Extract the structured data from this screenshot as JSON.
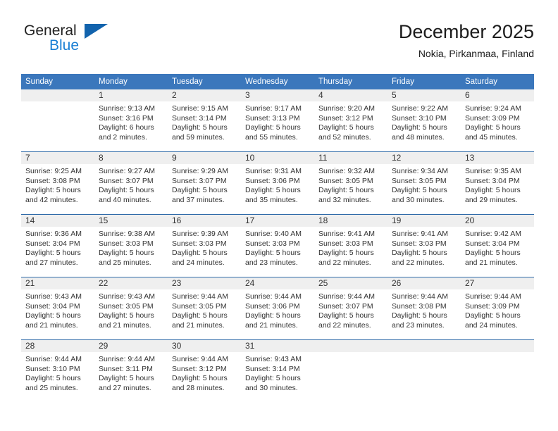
{
  "brand": {
    "line1": "General",
    "line2": "Blue",
    "triangle_color": "#1263ad",
    "blue_color": "#1a7fd4"
  },
  "header": {
    "title": "December 2025",
    "subtitle": "Nokia, Pirkanmaa, Finland"
  },
  "theme": {
    "header_row_bg": "#3b77bc",
    "header_row_text": "#ffffff",
    "week_divider": "#2e6aa8",
    "date_band_bg": "#efefef",
    "body_text": "#333333"
  },
  "weekday_headers": [
    "Sunday",
    "Monday",
    "Tuesday",
    "Wednesday",
    "Thursday",
    "Friday",
    "Saturday"
  ],
  "weeks": [
    [
      {
        "date": "",
        "sunrise": "",
        "sunset": "",
        "daylight_line1": "",
        "daylight_line2": "",
        "empty": true
      },
      {
        "date": "1",
        "sunrise": "Sunrise: 9:13 AM",
        "sunset": "Sunset: 3:16 PM",
        "daylight_line1": "Daylight: 6 hours",
        "daylight_line2": "and 2 minutes.",
        "empty": false
      },
      {
        "date": "2",
        "sunrise": "Sunrise: 9:15 AM",
        "sunset": "Sunset: 3:14 PM",
        "daylight_line1": "Daylight: 5 hours",
        "daylight_line2": "and 59 minutes.",
        "empty": false
      },
      {
        "date": "3",
        "sunrise": "Sunrise: 9:17 AM",
        "sunset": "Sunset: 3:13 PM",
        "daylight_line1": "Daylight: 5 hours",
        "daylight_line2": "and 55 minutes.",
        "empty": false
      },
      {
        "date": "4",
        "sunrise": "Sunrise: 9:20 AM",
        "sunset": "Sunset: 3:12 PM",
        "daylight_line1": "Daylight: 5 hours",
        "daylight_line2": "and 52 minutes.",
        "empty": false
      },
      {
        "date": "5",
        "sunrise": "Sunrise: 9:22 AM",
        "sunset": "Sunset: 3:10 PM",
        "daylight_line1": "Daylight: 5 hours",
        "daylight_line2": "and 48 minutes.",
        "empty": false
      },
      {
        "date": "6",
        "sunrise": "Sunrise: 9:24 AM",
        "sunset": "Sunset: 3:09 PM",
        "daylight_line1": "Daylight: 5 hours",
        "daylight_line2": "and 45 minutes.",
        "empty": false
      }
    ],
    [
      {
        "date": "7",
        "sunrise": "Sunrise: 9:25 AM",
        "sunset": "Sunset: 3:08 PM",
        "daylight_line1": "Daylight: 5 hours",
        "daylight_line2": "and 42 minutes.",
        "empty": false
      },
      {
        "date": "8",
        "sunrise": "Sunrise: 9:27 AM",
        "sunset": "Sunset: 3:07 PM",
        "daylight_line1": "Daylight: 5 hours",
        "daylight_line2": "and 40 minutes.",
        "empty": false
      },
      {
        "date": "9",
        "sunrise": "Sunrise: 9:29 AM",
        "sunset": "Sunset: 3:07 PM",
        "daylight_line1": "Daylight: 5 hours",
        "daylight_line2": "and 37 minutes.",
        "empty": false
      },
      {
        "date": "10",
        "sunrise": "Sunrise: 9:31 AM",
        "sunset": "Sunset: 3:06 PM",
        "daylight_line1": "Daylight: 5 hours",
        "daylight_line2": "and 35 minutes.",
        "empty": false
      },
      {
        "date": "11",
        "sunrise": "Sunrise: 9:32 AM",
        "sunset": "Sunset: 3:05 PM",
        "daylight_line1": "Daylight: 5 hours",
        "daylight_line2": "and 32 minutes.",
        "empty": false
      },
      {
        "date": "12",
        "sunrise": "Sunrise: 9:34 AM",
        "sunset": "Sunset: 3:05 PM",
        "daylight_line1": "Daylight: 5 hours",
        "daylight_line2": "and 30 minutes.",
        "empty": false
      },
      {
        "date": "13",
        "sunrise": "Sunrise: 9:35 AM",
        "sunset": "Sunset: 3:04 PM",
        "daylight_line1": "Daylight: 5 hours",
        "daylight_line2": "and 29 minutes.",
        "empty": false
      }
    ],
    [
      {
        "date": "14",
        "sunrise": "Sunrise: 9:36 AM",
        "sunset": "Sunset: 3:04 PM",
        "daylight_line1": "Daylight: 5 hours",
        "daylight_line2": "and 27 minutes.",
        "empty": false
      },
      {
        "date": "15",
        "sunrise": "Sunrise: 9:38 AM",
        "sunset": "Sunset: 3:03 PM",
        "daylight_line1": "Daylight: 5 hours",
        "daylight_line2": "and 25 minutes.",
        "empty": false
      },
      {
        "date": "16",
        "sunrise": "Sunrise: 9:39 AM",
        "sunset": "Sunset: 3:03 PM",
        "daylight_line1": "Daylight: 5 hours",
        "daylight_line2": "and 24 minutes.",
        "empty": false
      },
      {
        "date": "17",
        "sunrise": "Sunrise: 9:40 AM",
        "sunset": "Sunset: 3:03 PM",
        "daylight_line1": "Daylight: 5 hours",
        "daylight_line2": "and 23 minutes.",
        "empty": false
      },
      {
        "date": "18",
        "sunrise": "Sunrise: 9:41 AM",
        "sunset": "Sunset: 3:03 PM",
        "daylight_line1": "Daylight: 5 hours",
        "daylight_line2": "and 22 minutes.",
        "empty": false
      },
      {
        "date": "19",
        "sunrise": "Sunrise: 9:41 AM",
        "sunset": "Sunset: 3:03 PM",
        "daylight_line1": "Daylight: 5 hours",
        "daylight_line2": "and 22 minutes.",
        "empty": false
      },
      {
        "date": "20",
        "sunrise": "Sunrise: 9:42 AM",
        "sunset": "Sunset: 3:04 PM",
        "daylight_line1": "Daylight: 5 hours",
        "daylight_line2": "and 21 minutes.",
        "empty": false
      }
    ],
    [
      {
        "date": "21",
        "sunrise": "Sunrise: 9:43 AM",
        "sunset": "Sunset: 3:04 PM",
        "daylight_line1": "Daylight: 5 hours",
        "daylight_line2": "and 21 minutes.",
        "empty": false
      },
      {
        "date": "22",
        "sunrise": "Sunrise: 9:43 AM",
        "sunset": "Sunset: 3:05 PM",
        "daylight_line1": "Daylight: 5 hours",
        "daylight_line2": "and 21 minutes.",
        "empty": false
      },
      {
        "date": "23",
        "sunrise": "Sunrise: 9:44 AM",
        "sunset": "Sunset: 3:05 PM",
        "daylight_line1": "Daylight: 5 hours",
        "daylight_line2": "and 21 minutes.",
        "empty": false
      },
      {
        "date": "24",
        "sunrise": "Sunrise: 9:44 AM",
        "sunset": "Sunset: 3:06 PM",
        "daylight_line1": "Daylight: 5 hours",
        "daylight_line2": "and 21 minutes.",
        "empty": false
      },
      {
        "date": "25",
        "sunrise": "Sunrise: 9:44 AM",
        "sunset": "Sunset: 3:07 PM",
        "daylight_line1": "Daylight: 5 hours",
        "daylight_line2": "and 22 minutes.",
        "empty": false
      },
      {
        "date": "26",
        "sunrise": "Sunrise: 9:44 AM",
        "sunset": "Sunset: 3:08 PM",
        "daylight_line1": "Daylight: 5 hours",
        "daylight_line2": "and 23 minutes.",
        "empty": false
      },
      {
        "date": "27",
        "sunrise": "Sunrise: 9:44 AM",
        "sunset": "Sunset: 3:09 PM",
        "daylight_line1": "Daylight: 5 hours",
        "daylight_line2": "and 24 minutes.",
        "empty": false
      }
    ],
    [
      {
        "date": "28",
        "sunrise": "Sunrise: 9:44 AM",
        "sunset": "Sunset: 3:10 PM",
        "daylight_line1": "Daylight: 5 hours",
        "daylight_line2": "and 25 minutes.",
        "empty": false
      },
      {
        "date": "29",
        "sunrise": "Sunrise: 9:44 AM",
        "sunset": "Sunset: 3:11 PM",
        "daylight_line1": "Daylight: 5 hours",
        "daylight_line2": "and 27 minutes.",
        "empty": false
      },
      {
        "date": "30",
        "sunrise": "Sunrise: 9:44 AM",
        "sunset": "Sunset: 3:12 PM",
        "daylight_line1": "Daylight: 5 hours",
        "daylight_line2": "and 28 minutes.",
        "empty": false
      },
      {
        "date": "31",
        "sunrise": "Sunrise: 9:43 AM",
        "sunset": "Sunset: 3:14 PM",
        "daylight_line1": "Daylight: 5 hours",
        "daylight_line2": "and 30 minutes.",
        "empty": false
      },
      {
        "date": "",
        "sunrise": "",
        "sunset": "",
        "daylight_line1": "",
        "daylight_line2": "",
        "empty": true
      },
      {
        "date": "",
        "sunrise": "",
        "sunset": "",
        "daylight_line1": "",
        "daylight_line2": "",
        "empty": true
      },
      {
        "date": "",
        "sunrise": "",
        "sunset": "",
        "daylight_line1": "",
        "daylight_line2": "",
        "empty": true
      }
    ]
  ]
}
